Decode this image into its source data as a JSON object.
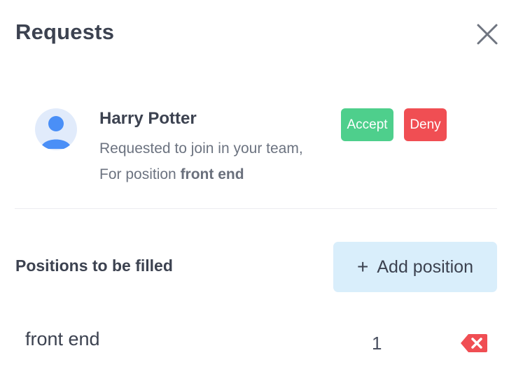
{
  "header": {
    "title": "Requests"
  },
  "request": {
    "name": "Harry Potter",
    "line1": "Requested to join in your team,",
    "line2_prefix": "For position ",
    "position": "front end",
    "accept_label": "Accept",
    "deny_label": "Deny"
  },
  "positions": {
    "title": "Positions to be filled",
    "add_label": "Add position",
    "add_icon": "+",
    "items": [
      {
        "name": "front end",
        "count": "1"
      }
    ]
  },
  "colors": {
    "accept": "#4ecf8c",
    "deny": "#f04e53",
    "add_button_bg": "#d9eefb",
    "avatar_bg": "#e1ebfb",
    "avatar_fg": "#4a8ff7"
  },
  "icons": {
    "close": "close-icon",
    "avatar": "user-avatar-icon",
    "delete": "backspace-delete-icon"
  }
}
